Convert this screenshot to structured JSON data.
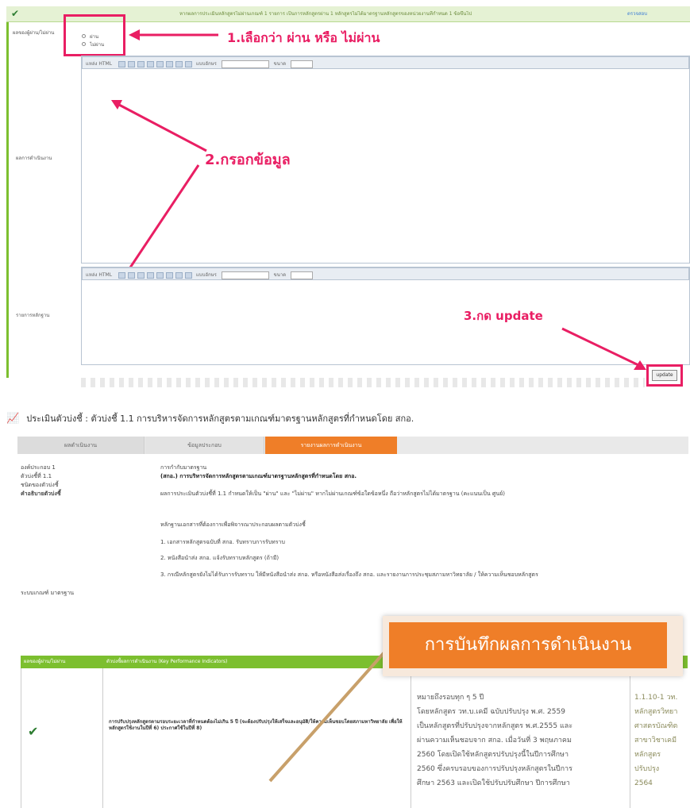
{
  "top_screen": {
    "header_note": "หากผลการประเมินหลักสูตรไม่ผ่านเกณฑ์ 1 รายการ เป็นการหลักสูตรผ่าน 1 หลักสูตรไม่ได้มาตรฐานหลักสูตรของหน่วยงานที่กำหนด 1 ข้อขึ้นไป",
    "header_link": "ตรวจสอบ",
    "result_label": "ผลของผู้ผ่าน/ไม่ผ่าน",
    "pass_option": "ผ่าน",
    "fail_option": "ไม่ผ่าน",
    "performance_label": "ผลการดำเนินงาน",
    "evidence_label": "รายการหลักฐาน",
    "toolbar_source": "แหล่ง HTML",
    "toolbar_font": "แบบอักษร",
    "toolbar_size": "ขนาด",
    "update_button": "update"
  },
  "annotations": {
    "step1": "1.เลือกว่า ผ่าน หรือ ไม่ผ่าน",
    "step2": "2.กรอกข้อมูล",
    "step3": "3.กด update"
  },
  "bottom_screen": {
    "title": "ประเมินตัวบ่งชี้ : ตัวบ่งชี้ 1.1 การบริหารจัดการหลักสูตรตามเกณฑ์มาตรฐานหลักสูตรที่กำหนดโดย สกอ.",
    "tabs": [
      "ผลดำเนินงาน",
      "ข้อมูลประกอบ",
      "รายงานผลการดำเนินงาน"
    ],
    "fields": {
      "component_label": "องค์ประกอบ 1",
      "component_value": "การกำกับมาตรฐาน",
      "indicator_label": "ตัวบ่งชี้ที่ 1.1",
      "indicator_value": "(สกอ.) การบริหารจัดการหลักสูตรตามเกณฑ์มาตรฐานหลักสูตรที่กำหนดโดย สกอ.",
      "type_label": "ชนิดของตัวบ่งชี้",
      "description_label": "คำอธิบายตัวบ่งชี้",
      "description_value": "ผลการประเมินตัวบ่งชี้ที่ 1.1 กำหนดให้เป็น \"ผ่าน\" และ \"ไม่ผ่าน\" หากไม่ผ่านเกณฑ์ข้อใดข้อหนึ่ง ถือว่าหลักสูตรไม่ได้มาตรฐาน (คะแนนเป็น ศูนย์)",
      "evidence_intro": "หลักฐานเอกสารที่ต้องการเพื่อพิจารณาประกอบผลตามตัวบ่งชี้",
      "evidence_1": "1.  เอกสารหลักสูตรฉบับที่ สกอ. รับทราบการรับทราบ",
      "evidence_2": "2.  หนังสือนำส่ง สกอ. แจ้งรับทราบหลักสูตร (ถ้ามี)",
      "evidence_3": "3.  กรณีหลักสูตรยังไม่ได้รับการรับทราบ ให้มีหนังสือนำส่ง สกอ. หรือหนังสือส่งเรื่องถึง สกอ. และรายงานการประชุมสภามหาวิทยาลัย / ให้ความเห็นชอบหลักสูตร",
      "criteria_label": "ระบบเกณฑ์ มาตรฐาน"
    },
    "table_header_left": "ผลของผู้ผ่าน/ไม่ผ่าน",
    "table_header_mid": "ตัวบ่งชี้ผลการดำเนินงาน (Key Performance Indicators)",
    "row_kpi": "การปรับปรุงหลักสูตรตามรอบระยะเวลาที่กำหนดต้องไม่เกิน 5 ปี (จะต้องปรับปรุงให้เสร็จและอนุมัติ/ให้ความเห็นชอบโดยสภามหาวิทยาลัย เพื่อให้หลักสูตรใช้งานในปีที่ 6) ประกาศใช้ในปีที่ 8)",
    "row_result_lines": [
      "หมายถึงรอบทุก ๆ 5 ปี",
      "โดยหลักสูตร วท.บ.เคมี ฉบับปรับปรุง พ.ศ. 2559",
      "เป็นหลักสูตรที่ปรับปรุงจากหลักสูตร พ.ศ.2555 และ",
      "ผ่านความเห็นชอบจาก สกอ. เมื่อวันที่ 3 พฤษภาคม",
      "2560 โดยเปิดใช้หลักสูตรปรับปรุงนี้ในปีการศึกษา",
      "2560 ซึ่งครบรอบของการปรับปรุงหลักสูตรในปีการ",
      "ศึกษา 2563 และเปิดใช้ปรับปรับศึกษา ปีการศึกษา"
    ],
    "row_evidence_lines": [
      "1.1.10-1 วท.",
      "หลักสูตรวิทยา",
      "ศาสตรบัณฑิต",
      "สาขาวิชาเคมี",
      "หลักสูตร",
      "ปรับปรุง",
      "2564"
    ],
    "callout": "การบันทึกผลการดำเนินงาน"
  },
  "colors": {
    "green": "#7cbf2f",
    "orange": "#ef7e28",
    "pink": "#e91e63",
    "check": "#2e7d32"
  }
}
